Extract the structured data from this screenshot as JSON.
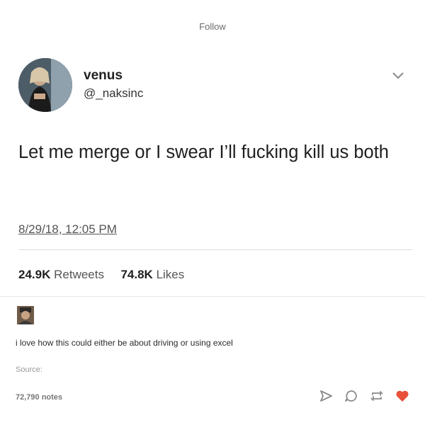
{
  "header": {
    "follow_label": "Follow"
  },
  "tweet": {
    "display_name": "venus",
    "handle": "@_naksinc",
    "text": "Let me merge or I swear I’ll fucking kill us both",
    "timestamp": "8/29/18, 12:05 PM",
    "retweets_count": "24.9K",
    "retweets_label": "Retweets",
    "likes_count": "74.8K",
    "likes_label": "Likes"
  },
  "post": {
    "comment": "i love how this could either be about driving or using excel",
    "source_label": "Source:",
    "notes": "72,790 notes"
  },
  "icons": {
    "chevron": "chevron-down-icon",
    "share": "share-icon",
    "reply": "reply-icon",
    "reblog": "reblog-icon",
    "like": "heart-icon"
  },
  "colors": {
    "like_heart": "#e8503a",
    "action_icon": "#8a8a8a"
  }
}
